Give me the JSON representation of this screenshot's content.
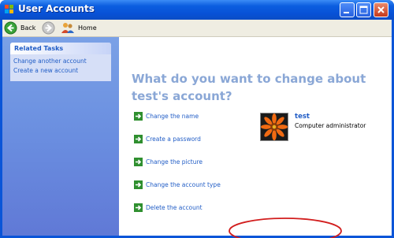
{
  "window": {
    "title": "User Accounts"
  },
  "toolbar": {
    "back_label": "Back",
    "home_label": "Home"
  },
  "sidebar": {
    "panel_title": "Related Tasks",
    "links": [
      {
        "label": "Change another account"
      },
      {
        "label": "Create a new account"
      }
    ]
  },
  "main": {
    "heading": "What do you want to change about test's account?",
    "actions": [
      {
        "label": "Change the name"
      },
      {
        "label": "Create a password"
      },
      {
        "label": "Change the picture"
      },
      {
        "label": "Change the account type"
      },
      {
        "label": "Delete the account"
      }
    ],
    "account": {
      "name": "test",
      "type": "Computer administrator"
    }
  },
  "annotation": {
    "highlighted_action": "Delete the account",
    "color": "#d21e1e"
  },
  "colors": {
    "link": "#215dc6",
    "heading": "#8aa7d6",
    "sidebar": "#6a8ee0",
    "titlebar": "#0b5ee0"
  }
}
